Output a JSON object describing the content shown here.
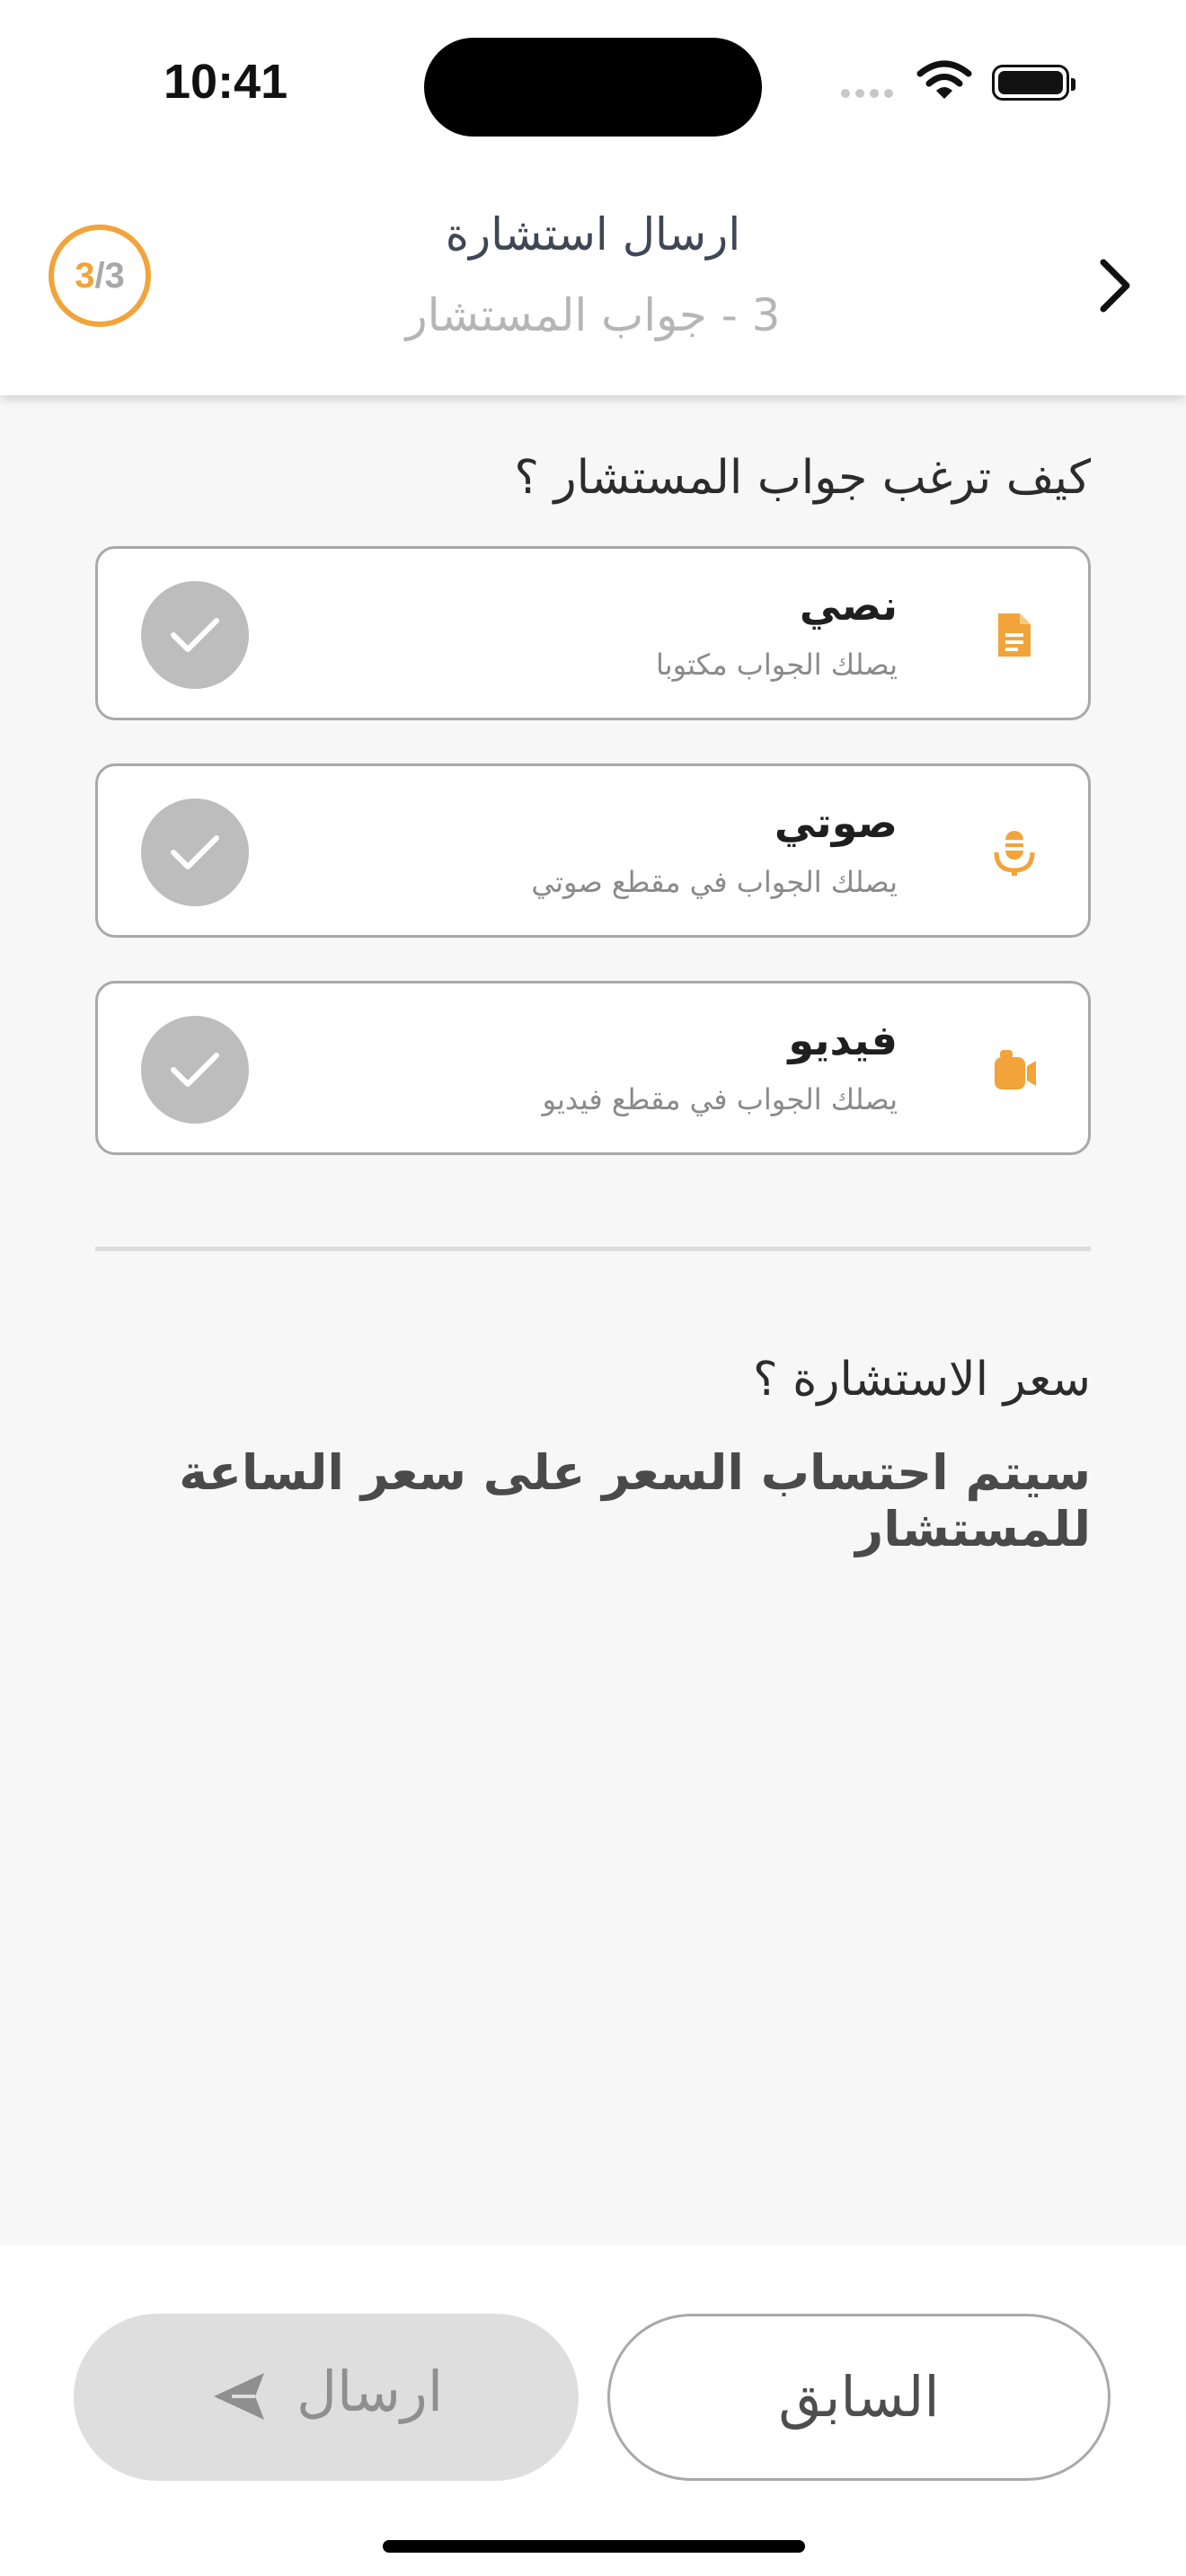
{
  "status_bar": {
    "time": "10:41"
  },
  "header": {
    "title": "ارسال استشارة",
    "subtitle": "3 - جواب المستشار",
    "step_current": "3",
    "step_total": "/3"
  },
  "question": "كيف ترغب جواب المستشار ؟",
  "options": [
    {
      "title": "نصي",
      "desc": "يصلك الجواب مكتوبا",
      "icon": "document-icon"
    },
    {
      "title": "صوتي",
      "desc": "يصلك الجواب في مقطع صوتي",
      "icon": "microphone-icon"
    },
    {
      "title": "فيديو",
      "desc": "يصلك الجواب في مقطع فيديو",
      "icon": "video-camera-icon"
    }
  ],
  "price": {
    "question": "سعر الاستشارة ؟",
    "note": "سيتم احتساب السعر على سعر الساعة للمستشار"
  },
  "buttons": {
    "previous": "السابق",
    "send": "ارسال"
  },
  "colors": {
    "accent": "#f2a33a",
    "check_bg": "#bdbdbd",
    "disabled_bg": "#dedede"
  }
}
